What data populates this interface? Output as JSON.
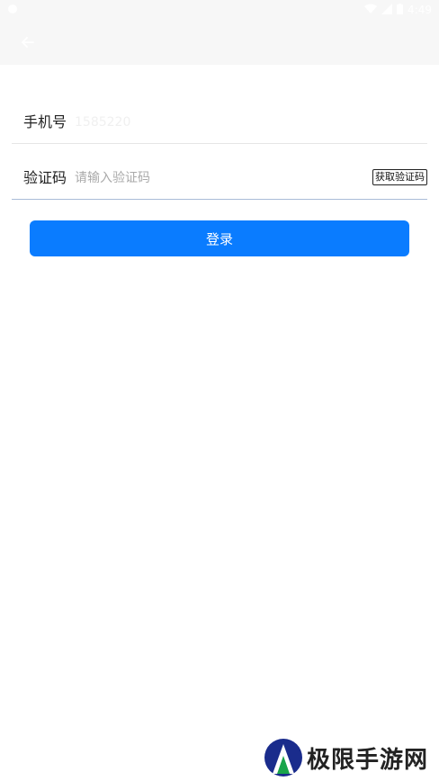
{
  "status_bar": {
    "time": "4:49"
  },
  "app_bar": {
    "back_icon": "arrow-left-icon"
  },
  "phone_field": {
    "label": "手机号",
    "value": "1585220"
  },
  "code_field": {
    "label": "验证码",
    "placeholder": "请输入验证码",
    "get_code_label": "获取验证码"
  },
  "login_button": {
    "label": "登录"
  },
  "watermark": {
    "text": "极限手游网"
  },
  "colors": {
    "primary": "#0a7cff",
    "app_bar_bg": "#f7f7f7",
    "divider": "#e6e6e6",
    "active_divider": "#a9bcd8"
  }
}
